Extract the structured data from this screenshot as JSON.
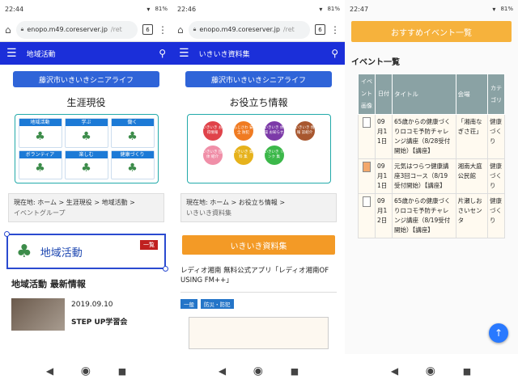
{
  "status": [
    {
      "time": "22:44",
      "battery": "81%"
    },
    {
      "time": "22:46",
      "battery": "81%"
    },
    {
      "time": "22:47",
      "battery": "81%"
    }
  ],
  "browser": {
    "url": "enopo.m49.coreserver.jp",
    "url_tail": "/ret",
    "tabs": "6"
  },
  "panel1": {
    "nav_title": "地域活動",
    "banner": "藤沢市いきいきシニアライフ",
    "section_title": "生涯現役",
    "tiles": [
      "地域活動",
      "学ぶ",
      "働く",
      "ボランティア",
      "楽しむ",
      "健康づくり"
    ],
    "breadcrumb": "現在地:  ホーム >  生涯現役 >  地域活動  >",
    "breadcrumb_sub": "イベントグループ",
    "selected_label": "地域活動",
    "list_button": "一覧",
    "news_heading": "地域活動 最新情報",
    "news_date": "2019.09.10",
    "news_title": "STEP UP学習会"
  },
  "panel2": {
    "nav_title": "いきいき資料集",
    "banner": "藤沢市いきいきシニアライフ",
    "section_title": "お役立ち情報",
    "circles": [
      {
        "label": "いきいき お得情報",
        "color": "#e0434a"
      },
      {
        "label": "ふじさわ 安全 防犯",
        "color": "#f07b22"
      },
      {
        "label": "いきいき 体操 お知らせ",
        "color": "#7c3aa8"
      },
      {
        "label": "いきいき 情報 誌紹介",
        "color": "#a8572f"
      },
      {
        "label": "いきいき 団体 紹介",
        "color": "#f08fa8"
      },
      {
        "label": "いきいき 資料 集",
        "color": "#e6b21c"
      },
      {
        "label": "いきいき リンク 集",
        "color": "#3cb84a"
      }
    ],
    "breadcrumb": "現在地:  ホーム >  お役立ち情報  >",
    "breadcrumb_sub": "いきいき資料集",
    "orange_button": "いきいき資料集",
    "app_text": "レディオ湘南 無料公式アプリ「レディオ湘南OF USING FM++」",
    "tags": [
      "一般",
      "防災・防犯"
    ]
  },
  "panel3": {
    "recommend_button": "おすすめイベント一覧",
    "title": "イベント一覧",
    "headers": [
      "イベント画像",
      "日付",
      "タイトル",
      "会場",
      "カテゴリ"
    ],
    "rows": [
      {
        "date": "09月11日",
        "title": "65歳からの健康づくりロコモ予防チャレンジ講座（8/28受付開始）【講座】",
        "venue": "「湘南なぎさ荘」",
        "category": "健康づくり"
      },
      {
        "date": "09月11日",
        "title": "元気はつらつ健康講座3回コース（8/19受付開始）【講座】",
        "venue": "湘南大庭公民館",
        "category": "健康づくり"
      },
      {
        "date": "09月12日",
        "title": "65歳からの健康づくりロコモ予防チャレンジ講座（8/19受付開始）【講座】",
        "venue": "片瀬しおさいセンタ",
        "category": "健康づくり"
      }
    ]
  },
  "colors": {
    "nav": "#1b2fd9",
    "banner": "#2f64d8",
    "orange": "#f39a26",
    "fab": "#2979ff"
  }
}
